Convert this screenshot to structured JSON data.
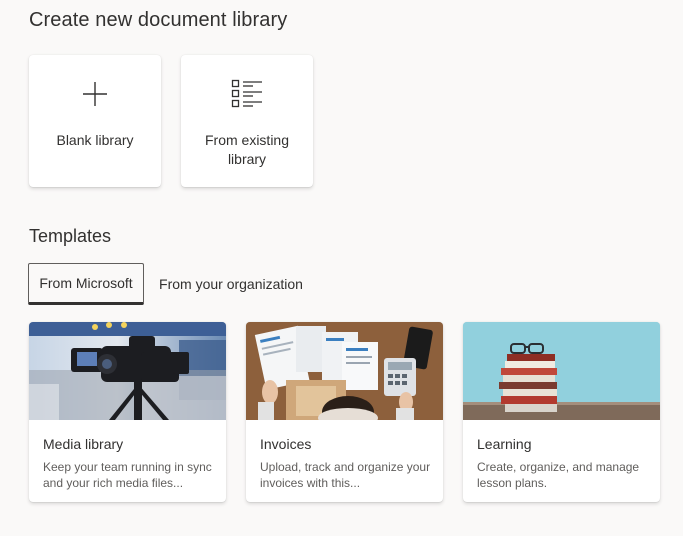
{
  "header": {
    "title": "Create new document library"
  },
  "create_options": [
    {
      "label": "Blank library",
      "icon": "plus-icon"
    },
    {
      "label": "From existing library",
      "icon": "list-icon"
    }
  ],
  "templates": {
    "title": "Templates",
    "tabs": [
      {
        "label": "From Microsoft",
        "selected": true
      },
      {
        "label": "From your organization",
        "selected": false
      }
    ],
    "cards": [
      {
        "name": "Media library",
        "description": "Keep your team running in sync and your rich media files...",
        "image": "media-production-photo"
      },
      {
        "name": "Invoices",
        "description": "Upload, track and organize your invoices with this...",
        "image": "invoices-desk-photo"
      },
      {
        "name": "Learning",
        "description": "Create, organize, and manage lesson plans.",
        "image": "stack-of-books-photo"
      }
    ]
  },
  "colors": {
    "background": "#faf9f8",
    "text": "#323130",
    "secondary_text": "#605e5c"
  }
}
